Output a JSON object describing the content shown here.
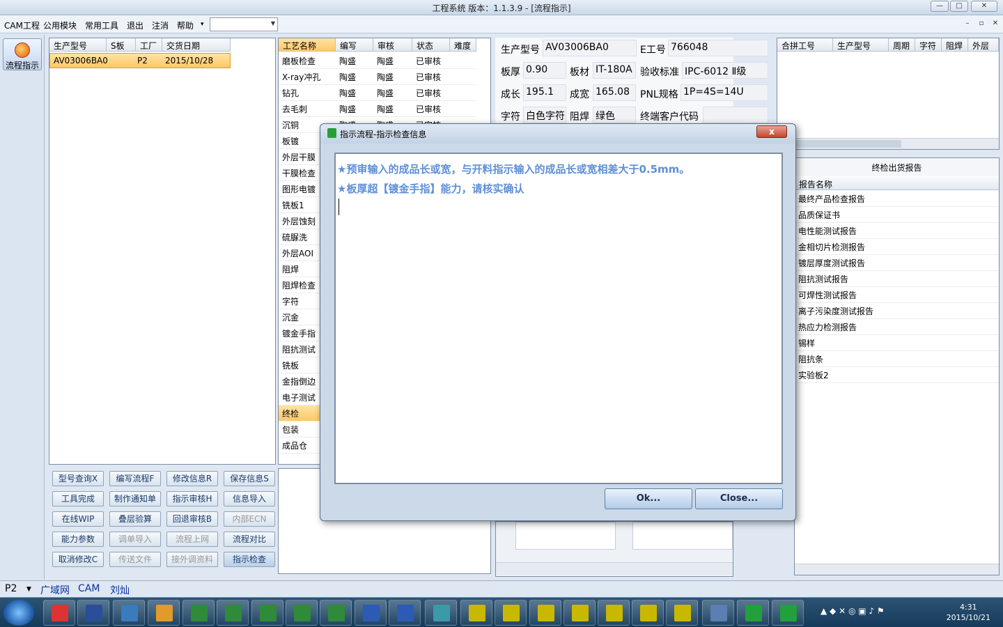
{
  "window": {
    "title": "工程系统   版本：1.1.3.9 - [流程指示]"
  },
  "menu": {
    "items": [
      "CAM工程",
      "公用模块",
      "常用工具",
      "退出",
      "注消",
      "帮助"
    ],
    "help_arrow": "▾",
    "combo_value": ""
  },
  "left_strip": {
    "flow_button": "流程指示"
  },
  "orders": {
    "columns": [
      "生产型号",
      "S板",
      "工厂",
      "交货日期"
    ],
    "rows": [
      [
        "AV03006BA0",
        "",
        "P2",
        "2015/10/28"
      ]
    ]
  },
  "process": {
    "columns": [
      "工艺名称",
      "编写",
      "审核",
      "状态",
      "难度"
    ],
    "rows": [
      [
        "磨板检查",
        "陶盛",
        "陶盛",
        "已审核",
        ""
      ],
      [
        "X-ray冲孔",
        "陶盛",
        "陶盛",
        "已审核",
        ""
      ],
      [
        "钻孔",
        "陶盛",
        "陶盛",
        "已审核",
        ""
      ],
      [
        "去毛刺",
        "陶盛",
        "陶盛",
        "已审核",
        ""
      ],
      [
        "沉铜",
        "陶盛",
        "陶盛",
        "已审核",
        ""
      ],
      [
        "板镀",
        "",
        "",
        "",
        ""
      ],
      [
        "外层干膜",
        "",
        "",
        "",
        ""
      ],
      [
        "干膜检查",
        "",
        "",
        "",
        ""
      ],
      [
        "图形电镀",
        "",
        "",
        "",
        ""
      ],
      [
        "铣板1",
        "",
        "",
        "",
        ""
      ],
      [
        "外层蚀刻",
        "",
        "",
        "",
        ""
      ],
      [
        "硫脲洗",
        "",
        "",
        "",
        ""
      ],
      [
        "外层AOI",
        "",
        "",
        "",
        ""
      ],
      [
        "阻焊",
        "",
        "",
        "",
        ""
      ],
      [
        "阻焊检查",
        "",
        "",
        "",
        ""
      ],
      [
        "字符",
        "",
        "",
        "",
        ""
      ],
      [
        "沉金",
        "",
        "",
        "",
        ""
      ],
      [
        "镀金手指",
        "",
        "",
        "",
        ""
      ],
      [
        "阻抗测试",
        "",
        "",
        "",
        ""
      ],
      [
        "铣板",
        "",
        "",
        "",
        ""
      ],
      [
        "金指倒边",
        "",
        "",
        "",
        ""
      ],
      [
        "电子测试",
        "",
        "",
        "",
        ""
      ],
      [
        "终检",
        "",
        "",
        "",
        ""
      ],
      [
        "包装",
        "",
        "",
        "",
        ""
      ],
      [
        "成品仓",
        "",
        "",
        "",
        ""
      ]
    ],
    "selected_row": "终检"
  },
  "buttons": [
    [
      "型号查询X",
      "编写流程F",
      "修改信息R",
      "保存信息S"
    ],
    [
      "工具完成",
      "制作通知单",
      "指示审核H",
      "信息导入"
    ],
    [
      "在线WIP",
      "叠层验算",
      "回退审核B",
      "内部ECN"
    ],
    [
      "能力参数",
      "调单导入",
      "流程上网",
      "流程对比"
    ],
    [
      "取消修改C",
      "传送文件",
      "接外调资料",
      "指示检查"
    ]
  ],
  "info": {
    "labels": {
      "model": "生产型号",
      "eno": "E工号",
      "thickness": "板厚",
      "material": "板材",
      "standard": "验收标准",
      "length": "成长",
      "width": "成宽",
      "pnl": "PNL规格",
      "char": "字符",
      "solder": "阻焊",
      "customer": "终端客户代码"
    },
    "values": {
      "model": "AV03006BA0",
      "eno": "766048",
      "thickness": "0.90",
      "material": "IT-180A",
      "standard": "IPC-6012 Ⅱ级",
      "length": "195.1",
      "width": "165.08",
      "pnl": "1P=4S=14U",
      "char": "白色字符",
      "solder": "绿色",
      "customer": ""
    }
  },
  "merge": {
    "columns": [
      "合拼工号",
      "生产型号",
      "周期",
      "字符",
      "阻焊",
      "外层"
    ]
  },
  "reports": {
    "title": "终检出货报告",
    "column": "报告名称",
    "items": [
      "最终产品检查报告",
      "品质保证书",
      "电性能测试报告",
      "金相切片检测报告",
      "镀层厚度测试报告",
      "阻抗测试报告",
      "可焊性测试报告",
      "离子污染度测试报告",
      "热应力检测报告",
      "锡样",
      "阻抗条",
      "实验板2"
    ]
  },
  "dialog": {
    "title": "指示流程-指示检查信息",
    "close_glyph": "x",
    "messages": [
      "★预审输入的成品长或宽，与开料指示输入的成品长或宽相差大于0.5mm。",
      "★板厚超【镀金手指】能力，请核实确认"
    ],
    "ok": "Ok...",
    "close": "Close..."
  },
  "status": {
    "factory": "P2",
    "items": [
      "广域网",
      "CAM",
      "刘灿"
    ]
  },
  "taskbar": {
    "time": "4:31",
    "date": "2015/10/21"
  },
  "colors": {
    "selected": "#ffc864",
    "accent": "#5f8fd6",
    "title": "#c9d9ea"
  }
}
